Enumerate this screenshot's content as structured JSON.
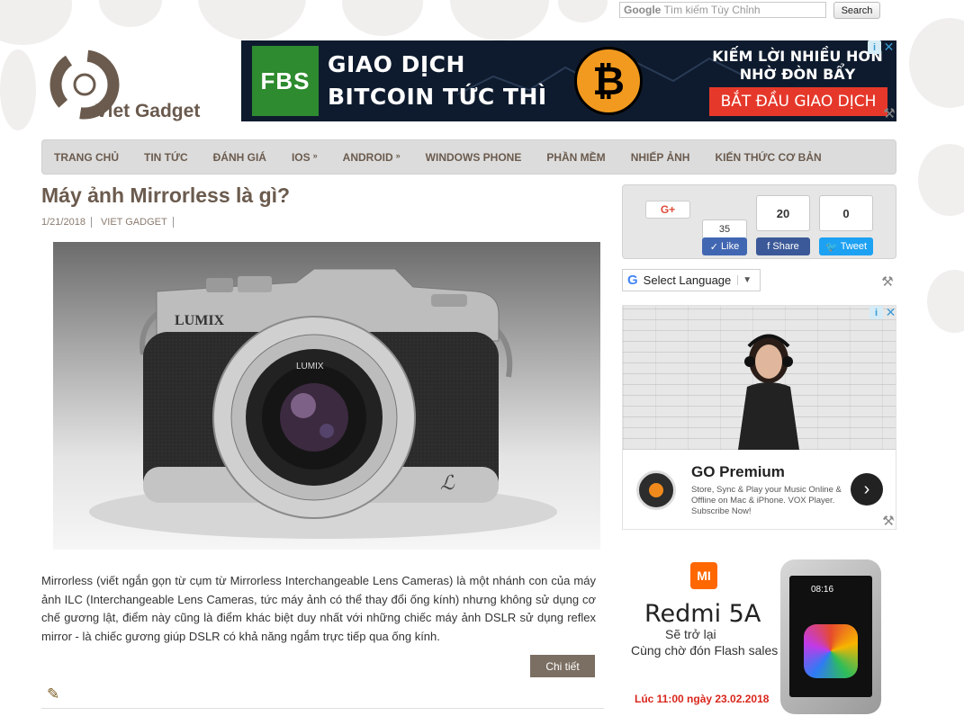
{
  "search": {
    "google_prefix": "Google",
    "placeholder": "Tìm kiếm Tùy Chỉnh",
    "button": "Search"
  },
  "logo": {
    "text": "Viet Gadget"
  },
  "top_ad": {
    "brand": "FBS",
    "line1": "GIAO DỊCH",
    "line2": "BITCOIN TỨC THÌ",
    "coin_symbol": "₿",
    "right_text": "KIẾM LỜI NHIỀU HƠN NHỜ ĐÒN BẨY",
    "cta": "BẮT ĐẦU GIAO DỊCH"
  },
  "nav": {
    "items": [
      {
        "label": "TRANG CHỦ"
      },
      {
        "label": "TIN TỨC"
      },
      {
        "label": "ĐÁNH GIÁ"
      },
      {
        "label": "IOS",
        "arrow": "»"
      },
      {
        "label": "ANDROID",
        "arrow": "»"
      },
      {
        "label": "WINDOWS PHONE"
      },
      {
        "label": "PHẦN MỀM"
      },
      {
        "label": "NHIẾP ẢNH"
      },
      {
        "label": "KIẾN THỨC CƠ BẢN"
      }
    ]
  },
  "article": {
    "title": "Máy ảnh Mirrorless là gì?",
    "date": "1/21/2018",
    "author": "VIET GADGET",
    "excerpt": "Mirrorless (viết ngắn gọn từ cụm từ Mirrorless Interchangeable Lens Cameras) là một nhánh con của máy ảnh ILC (Interchangeable Lens Cameras, tức máy ảnh có thể thay đổi ống kính) nhưng không sử dụng cơ chế gương lật, điểm này cũng là điểm khác biệt duy nhất với những chiếc máy ảnh DSLR sử dụng reflex mirror - là chiếc gương giúp DSLR có khả năng ngắm trực tiếp qua ống kính.",
    "read_more": "Chi tiết",
    "camera_brand": "LUMIX",
    "lens_text": "LUMIX"
  },
  "share": {
    "gplus": "G+",
    "fb_like_count": "35",
    "fb_like": "Like",
    "fb_share_count": "20",
    "fb_share": "Share",
    "tw_count": "0",
    "tw": "Tweet"
  },
  "translate": {
    "label": "Select Language",
    "caret": "▼"
  },
  "go_ad": {
    "title": "GO Premium",
    "desc": "Store, Sync & Play your Music Online & Offline on Mac & iPhone. VOX Player. Subscribe Now!",
    "next": "›"
  },
  "mi_ad": {
    "logo": "MI",
    "title": "Redmi 5A",
    "sub1": "Sẽ trở lại",
    "sub2": "Cùng chờ đón Flash sales",
    "date": "Lúc 11:00 ngày 23.02.2018",
    "phone_time": "08:16"
  },
  "icons": {
    "adchoices": "i",
    "close": "✕",
    "tool": "⚒",
    "pencil": "✎"
  },
  "colors": {
    "brand_brown": "#6b5b4e",
    "nav_bg": "#dcdcdc",
    "readmore_bg": "#7b6e62",
    "fbs_green": "#2e8b2f",
    "cta_red": "#e5382a",
    "bitcoin_orange": "#f29a1f",
    "mi_orange": "#ff6700"
  }
}
